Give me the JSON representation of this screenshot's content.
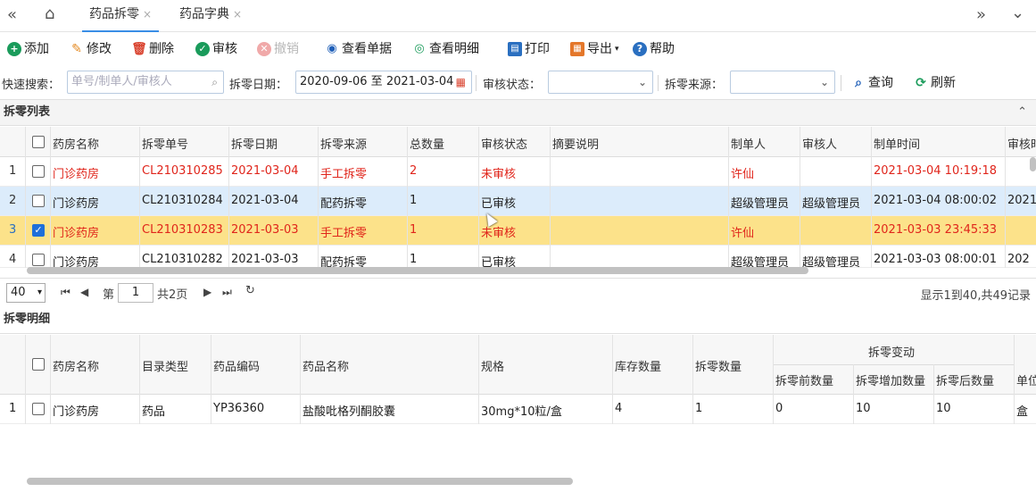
{
  "tabbar": {
    "back_icon": "double-left-chevron",
    "home_icon": "home",
    "tabs": [
      {
        "label": "药品拆零",
        "active": true
      },
      {
        "label": "药品字典",
        "active": false
      }
    ],
    "close_glyph": "×",
    "forward_icon": "double-right-chevron",
    "menu_icon": "chevron-down"
  },
  "toolbar": {
    "add": "添加",
    "edit": "修改",
    "delete": "删除",
    "audit": "审核",
    "revoke": "撤销",
    "view_doc": "查看单据",
    "view_detail": "查看明细",
    "print": "打印",
    "export": "导出",
    "help": "帮助"
  },
  "search": {
    "quick_label": "快速搜索：",
    "quick_placeholder": "单号/制单人/审核人",
    "date_label": "拆零日期：",
    "date_value": "2020-09-06 至 2021-03-04",
    "status_label": "审核状态：",
    "status_value": "",
    "source_label": "拆零来源：",
    "source_value": "",
    "query": "查询",
    "refresh": "刷新"
  },
  "list": {
    "title": "拆零列表",
    "columns": [
      "药房名称",
      "拆零单号",
      "拆零日期",
      "拆零来源",
      "总数量",
      "审核状态",
      "摘要说明",
      "制单人",
      "审核人",
      "制单时间",
      "审核时"
    ],
    "rows": [
      {
        "no": "1",
        "pharmacy": "门诊药房",
        "code": "CL210310285",
        "date": "2021-03-04",
        "source": "手工拆零",
        "qty": "2",
        "status": "未审核",
        "summary": "",
        "maker": "许仙",
        "auditor": "",
        "make_time": "2021-03-04 10:19:18",
        "audit_time": "",
        "style": "red"
      },
      {
        "no": "2",
        "pharmacy": "门诊药房",
        "code": "CL210310284",
        "date": "2021-03-04",
        "source": "配药拆零",
        "qty": "1",
        "status": "已审核",
        "summary": "",
        "maker": "超级管理员",
        "auditor": "超级管理员",
        "make_time": "2021-03-04 08:00:02",
        "audit_time": "2021",
        "style": "sel"
      },
      {
        "no": "3",
        "pharmacy": "门诊药房",
        "code": "CL210310283",
        "date": "2021-03-03",
        "source": "手工拆零",
        "qty": "1",
        "status": "未审核",
        "summary": "",
        "maker": "许仙",
        "auditor": "",
        "make_time": "2021-03-03 23:45:33",
        "audit_time": "",
        "style": "checked"
      },
      {
        "no": "4",
        "pharmacy": "门诊药房",
        "code": "CL210310282",
        "date": "2021-03-03",
        "source": "配药拆零",
        "qty": "1",
        "status": "已审核",
        "summary": "",
        "maker": "超级管理员",
        "auditor": "超级管理员",
        "make_time": "2021-03-03 08:00:01",
        "audit_time": "202",
        "style": "normal"
      }
    ]
  },
  "pager": {
    "page_size": "40",
    "page_label": "第",
    "page_value": "1",
    "total_pages": "共2页",
    "info": "显示1到40,共49记录"
  },
  "detail": {
    "title": "拆零明细",
    "columns": [
      "药房名称",
      "目录类型",
      "药品编码",
      "药品名称",
      "规格",
      "库存数量",
      "拆零数量"
    ],
    "group_header": "拆零变动",
    "sub_columns": [
      "拆零前数量",
      "拆零增加数量",
      "拆零后数量"
    ],
    "last_col": "单位",
    "rows": [
      {
        "no": "1",
        "pharmacy": "门诊药房",
        "type": "药品",
        "code": "YP36360",
        "name": "盐酸吡格列酮胶囊",
        "spec": "30mg*10粒/盒",
        "stock": "4",
        "split": "1",
        "before": "0",
        "add": "10",
        "after": "10",
        "unit": "盒"
      }
    ]
  }
}
